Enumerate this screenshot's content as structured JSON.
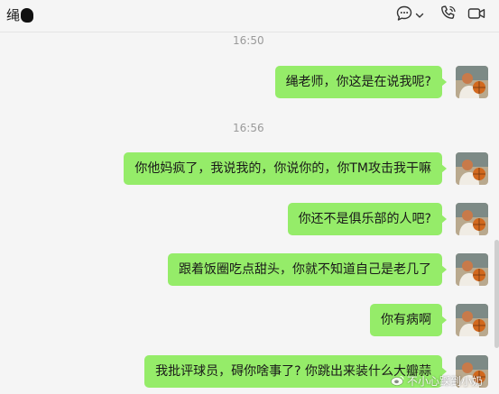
{
  "header": {
    "title": "绳"
  },
  "messages": [
    {
      "type": "time",
      "text": "16:50"
    },
    {
      "type": "sent",
      "text": "绳老师，你这是在说我呢?"
    },
    {
      "type": "time",
      "text": "16:56"
    },
    {
      "type": "sent",
      "text": "你他妈疯了，我说我的，你说你的，你TM攻击我干嘛"
    },
    {
      "type": "sent",
      "text": "你还不是俱乐部的人吧?"
    },
    {
      "type": "sent",
      "text": "跟着饭圈吃点甜头，你就不知道自己是老几了"
    },
    {
      "type": "sent",
      "text": "你有病啊"
    },
    {
      "type": "sent",
      "text": "我批评球员，碍你啥事了? 你跳出来装什么大瓣蒜"
    }
  ],
  "watermark": {
    "text": "不小心踩到小奶"
  },
  "colors": {
    "background": "#f5f5f5",
    "bubble_sent": "#95ec69",
    "timestamp": "#9a9a9a"
  },
  "icons": [
    "chat-bubble-icon",
    "chevron-down-icon",
    "phone-call-icon",
    "weibo-icon"
  ]
}
